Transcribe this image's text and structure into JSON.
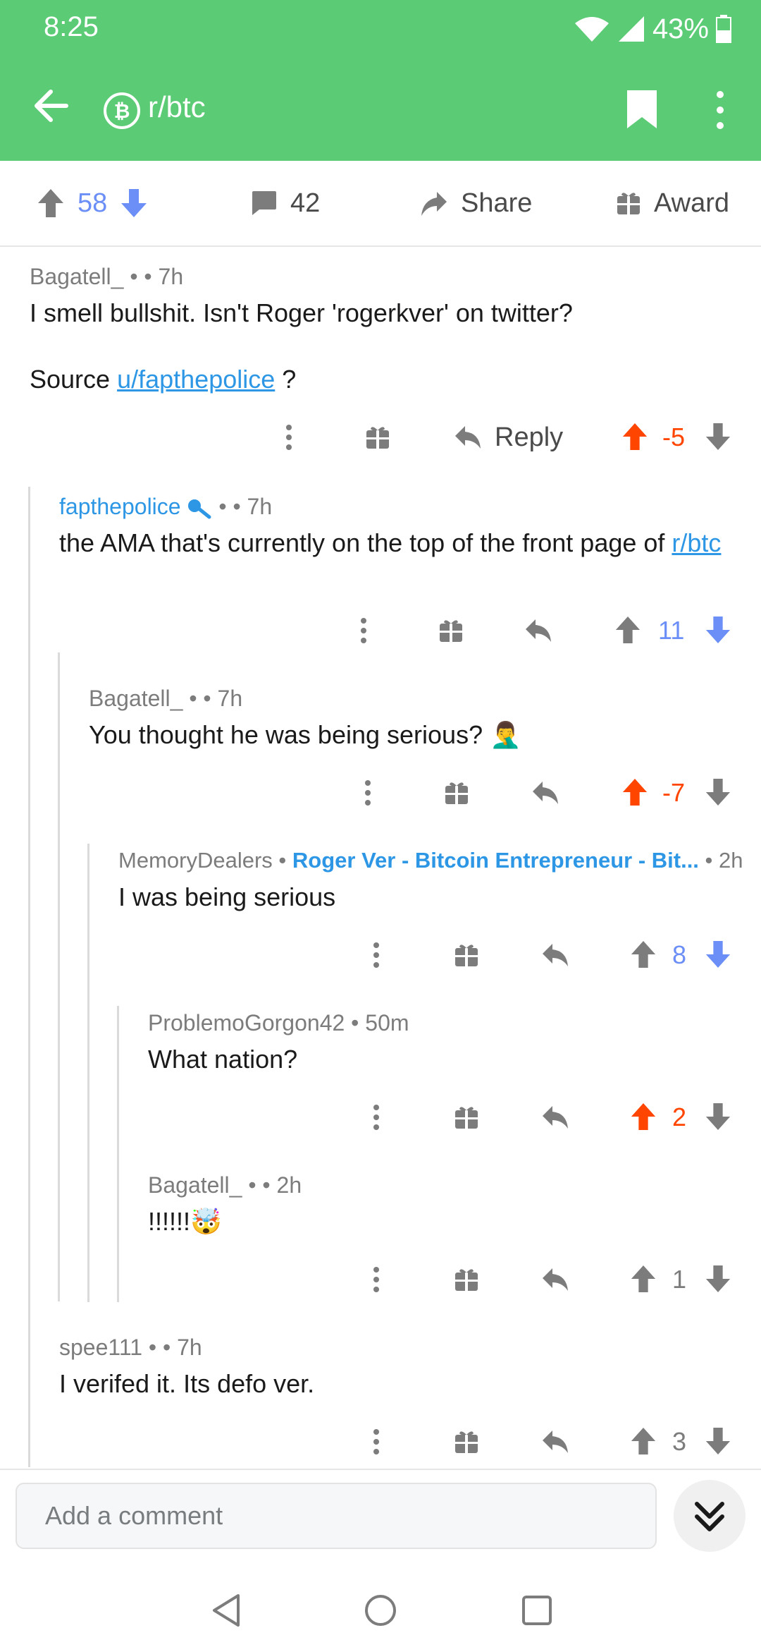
{
  "status": {
    "time": "8:25",
    "battery": "43%"
  },
  "appbar": {
    "subreddit": "r/btc"
  },
  "post_bar": {
    "upvotes": "58",
    "comments": "42",
    "share_label": "Share",
    "award_label": "Award"
  },
  "comments": [
    {
      "author": "Bagatell_",
      "sep": "•",
      "time": "• 7h",
      "body": "I smell bullshit. Isn't Roger 'rogerkver' on twitter?",
      "body2_prefix": "Source ",
      "body2_link": "u/fapthepolice",
      "body2_suffix": " ?",
      "reply_label": "Reply",
      "score": "-5"
    },
    {
      "author": "fapthepolice",
      "sep": "•",
      "time": "• 7h",
      "body": "the AMA that's currently on the top of the front page of ",
      "body_link": "r/btc",
      "score": "11"
    },
    {
      "author": "Bagatell_",
      "sep": "•",
      "time": "• 7h",
      "body": "You thought he was being serious?",
      "emoji": "🤦‍♂️",
      "score": "-7"
    },
    {
      "author": "MemoryDealers",
      "sep": "•",
      "flair": "Roger Ver - Bitcoin Entrepreneur - Bit...",
      "time": "• 2h",
      "body": "I was being serious",
      "score": "8"
    },
    {
      "author": "ProblemoGorgon42",
      "time": "• 50m",
      "body": "What nation?",
      "score": "2"
    },
    {
      "author": "Bagatell_",
      "sep": "•",
      "time": "• 2h",
      "body": "!!!!!!",
      "emoji": "🤯",
      "score": "1"
    },
    {
      "author": "spee111",
      "sep": "•",
      "time": "• 7h",
      "body": "I verifed it. Its defo ver.",
      "score": "3"
    }
  ],
  "composer": {
    "placeholder": "Add a comment"
  },
  "colors": {
    "brand": "#5ccb76",
    "upvote": "#ff4500",
    "downvote": "#6c8ff7",
    "link": "#2d97e5"
  },
  "icons": [
    "back-arrow-icon",
    "bitcoin-icon",
    "bookmark-icon",
    "more-vertical-icon",
    "upvote-icon",
    "downvote-icon",
    "comment-icon",
    "share-icon",
    "gift-icon",
    "reply-icon",
    "collapse-icon"
  ]
}
